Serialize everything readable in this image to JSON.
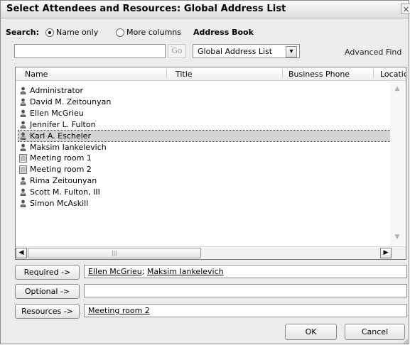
{
  "window": {
    "title": "Select Attendees and Resources: Global Address List",
    "close_glyph": "×"
  },
  "search": {
    "label": "Search:",
    "option_name_only": "Name only",
    "option_more_columns": "More columns",
    "selected": "Name only",
    "input_value": "",
    "go_label": "Go"
  },
  "address_book": {
    "label": "Address Book",
    "selected": "Global Address List",
    "advanced_find": "Advanced Find"
  },
  "list": {
    "columns": [
      "Name",
      "Title",
      "Business Phone",
      "Locatic"
    ],
    "rows": [
      {
        "name": "Administrator",
        "icon": "user-icon"
      },
      {
        "name": "David M. Zeitounyan",
        "icon": "user-icon"
      },
      {
        "name": "Ellen McGrieu",
        "icon": "user-icon"
      },
      {
        "name": "Jennifer L. Fulton",
        "icon": "user-icon"
      },
      {
        "name": "Karl A. Escheler",
        "icon": "user-icon",
        "selected": true
      },
      {
        "name": "Maksim Iankelevich",
        "icon": "user-icon"
      },
      {
        "name": "Meeting room 1",
        "icon": "room-icon"
      },
      {
        "name": "Meeting room 2",
        "icon": "room-icon"
      },
      {
        "name": "Rima Zeitounyan",
        "icon": "user-icon"
      },
      {
        "name": "Scott M. Fulton, III",
        "icon": "user-icon"
      },
      {
        "name": "Simon McAskill",
        "icon": "user-icon"
      }
    ],
    "hscroll_thumb_glyph": "|||"
  },
  "recipients": {
    "required_label": "Required ->",
    "required_names": [
      "Ellen McGrieu",
      "Maksim Iankelevich"
    ],
    "required_separator": "; ",
    "optional_label": "Optional ->",
    "optional_value": "",
    "resources_label": "Resources ->",
    "resources_value": "Meeting room 2"
  },
  "footer": {
    "ok_label": "OK",
    "cancel_label": "Cancel"
  },
  "colors": {
    "selection": "#d4d4d4",
    "window_bg": "#ececec"
  }
}
